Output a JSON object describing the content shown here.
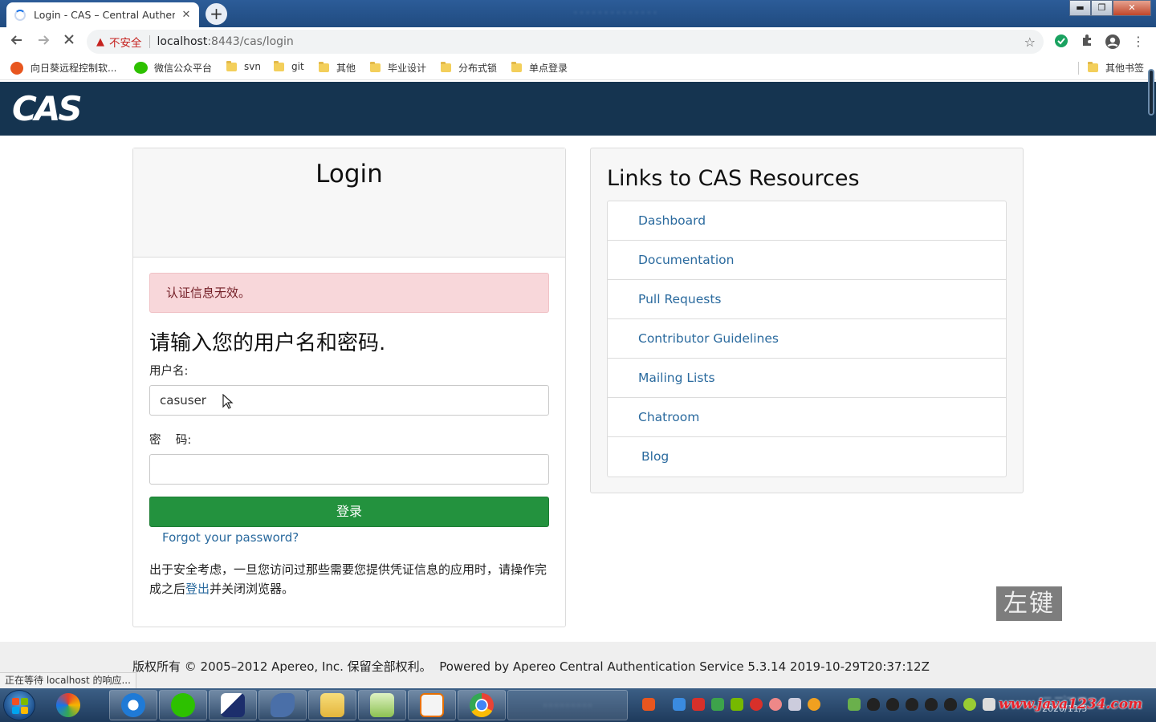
{
  "browser": {
    "tab_title": "Login - CAS – Central Authentication Service",
    "tab_close": "✕",
    "new_tab": "+",
    "window_controls": {
      "minimize": "▬",
      "maximize": "❐",
      "close": "✕"
    },
    "security_label": "不安全",
    "url_host": "localhost",
    "url_rest": ":8443/cas/login",
    "bookmarks": [
      {
        "label": "向日葵远程控制软...",
        "icon": "sunflower-icon"
      },
      {
        "label": "微信公众平台",
        "icon": "wechat-icon"
      },
      {
        "label": "svn",
        "icon": "folder-icon"
      },
      {
        "label": "git",
        "icon": "folder-icon"
      },
      {
        "label": "其他",
        "icon": "folder-icon"
      },
      {
        "label": "毕业设计",
        "icon": "folder-icon"
      },
      {
        "label": "分布式锁",
        "icon": "folder-icon"
      },
      {
        "label": "单点登录",
        "icon": "folder-icon"
      }
    ],
    "other_bookmarks": "其他书签",
    "status_text": "正在等待 localhost 的响应..."
  },
  "header": {
    "logo_text": "CAS"
  },
  "login": {
    "title": "Login",
    "error_message": "认证信息无效。",
    "prompt": "请输入您的用户名和密码.",
    "username_label": "用户名:",
    "username_value": "casuser",
    "password_label": "密    码:",
    "password_value": "",
    "submit_label": "登录",
    "forgot_link": "Forgot your password?",
    "notice_before": "出于安全考虑，一旦您访问过那些需要您提供凭证信息的应用时，请操作完成之后",
    "notice_link": "登出",
    "notice_after": "并关闭浏览器。"
  },
  "resources": {
    "title": "Links to CAS Resources",
    "links": [
      "Dashboard",
      "Documentation",
      "Pull Requests",
      "Contributor Guidelines",
      "Mailing Lists",
      "Chatroom",
      "Blog"
    ]
  },
  "overlay": {
    "key_label": "左键"
  },
  "footer": {
    "copyright": "版权所有 © 2005–2012 Apereo, Inc. 保留全部权利。",
    "powered_by": "Powered by Apereo Central Authentication Service 5.3.14 2019-10-29T20:37:12Z"
  },
  "taskbar": {
    "watermark": "www.java1234.com",
    "date": "2020/11/5"
  },
  "colors": {
    "header_bg": "#153450",
    "submit_bg": "#23923e",
    "alert_bg": "#f8d7da",
    "link": "#2a6a9e"
  }
}
